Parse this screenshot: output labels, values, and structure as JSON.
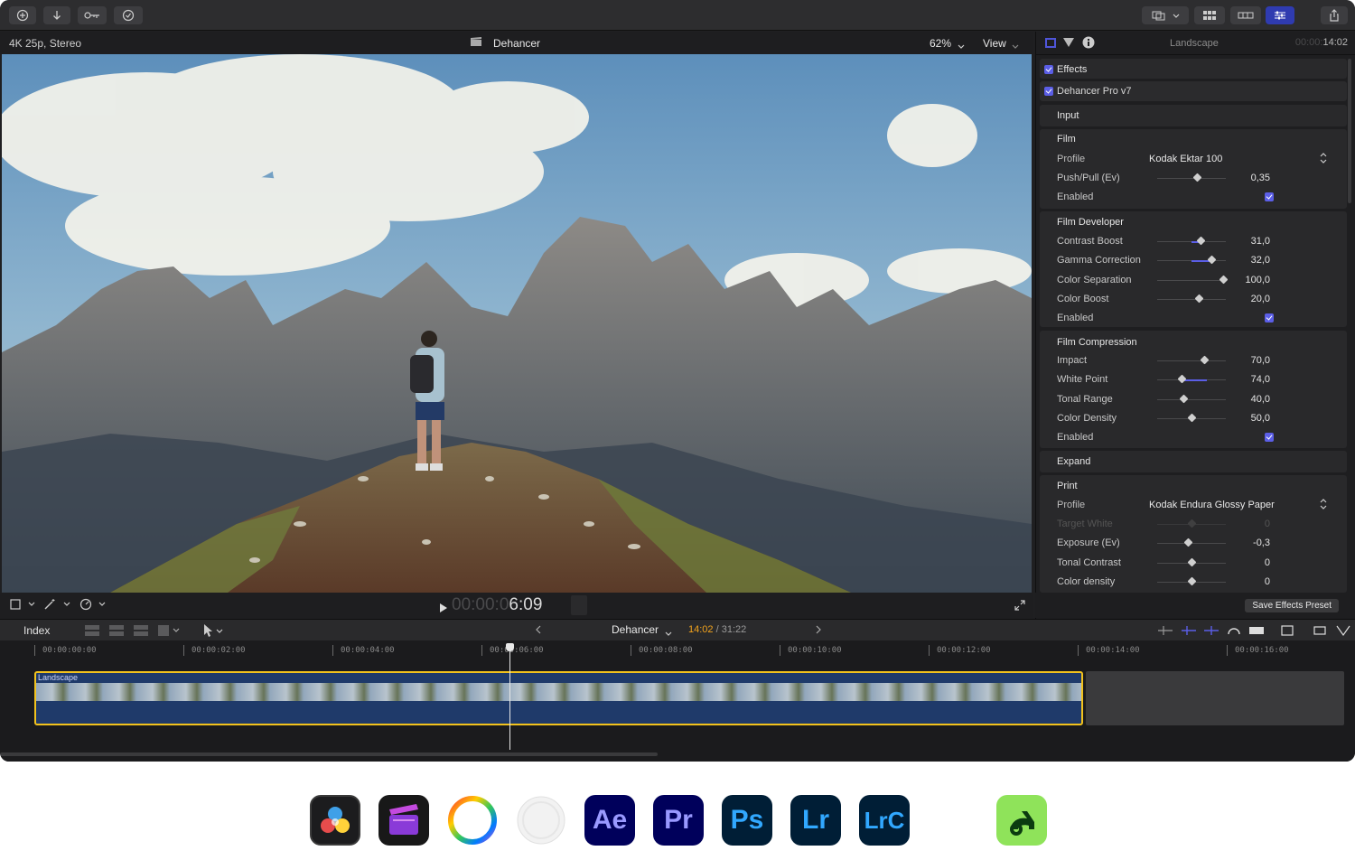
{
  "toolbar": {
    "left_buttons": [
      "add-media-icon",
      "import-icon",
      "keyword-icon",
      "checkmark-icon"
    ],
    "right_buttons": [
      "browser-toggle-icon",
      "dropdown-chevron-icon",
      "grid-view-icon",
      "filmstrip-icon",
      "inspector-icon",
      "share-icon"
    ]
  },
  "viewer": {
    "format": "4K 25p, Stereo",
    "title": "Dehancer",
    "zoom": "62%",
    "view_label": "View",
    "timecode_dim": "00:00:0",
    "timecode_bright": "6:09"
  },
  "inspector": {
    "clip_name": "Landscape",
    "duration_dim": "00:00:",
    "duration": "14:02",
    "effects_label": "Effects",
    "plugin_label": "Dehancer Pro v7",
    "input_label": "Input",
    "film": {
      "title": "Film",
      "profile_label": "Profile",
      "profile_value": "Kodak Ektar 100",
      "rows": [
        {
          "label": "Push/Pull (Ev)",
          "value": "0,35",
          "pos": 0.58
        },
        {
          "label": "Enabled",
          "value": ""
        }
      ]
    },
    "film_developer": {
      "title": "Film Developer",
      "rows": [
        {
          "label": "Contrast Boost",
          "value": "31,0",
          "pos": 0.63,
          "fill_from": 0.5
        },
        {
          "label": "Gamma Correction",
          "value": "32,0",
          "pos": 0.79,
          "fill_from": 0.5
        },
        {
          "label": "Color Separation",
          "value": "100,0",
          "pos": 0.96
        },
        {
          "label": "Color Boost",
          "value": "20,0",
          "pos": 0.6
        },
        {
          "label": "Enabled",
          "value": ""
        }
      ]
    },
    "film_compression": {
      "title": "Film Compression",
      "rows": [
        {
          "label": "Impact",
          "value": "70,0",
          "pos": 0.68
        },
        {
          "label": "White Point",
          "value": "74,0",
          "pos": 0.35,
          "fill_to": 0.72
        },
        {
          "label": "Tonal Range",
          "value": "40,0",
          "pos": 0.38
        },
        {
          "label": "Color Density",
          "value": "50,0",
          "pos": 0.5
        },
        {
          "label": "Enabled",
          "value": ""
        }
      ]
    },
    "expand_label": "Expand",
    "print": {
      "title": "Print",
      "profile_label": "Profile",
      "profile_value": "Kodak Endura Glossy Paper",
      "rows": [
        {
          "label": "Target White",
          "value": "0",
          "dim": true,
          "pos": 0.5
        },
        {
          "label": "Exposure (Ev)",
          "value": "-0,3",
          "pos": 0.45
        },
        {
          "label": "Tonal Contrast",
          "value": "0",
          "pos": 0.5
        },
        {
          "label": "Color density",
          "value": "0",
          "pos": 0.5
        }
      ]
    },
    "save_preset": "Save Effects Preset"
  },
  "timeline": {
    "index_label": "Index",
    "project_name": "Dehancer",
    "position": "14:02",
    "total": "/ 31:22",
    "ruler": [
      "00:00:00:00",
      "00:00:02:00",
      "00:00:04:00",
      "00:00:06:00",
      "00:00:08:00",
      "00:00:10:00",
      "00:00:12:00",
      "00:00:14:00",
      "00:00:16:00"
    ],
    "clip_label": "Landscape"
  },
  "dock": [
    {
      "name": "davinci-resolve-icon",
      "text": ""
    },
    {
      "name": "final-cut-pro-icon",
      "text": ""
    },
    {
      "name": "color-wheel-icon",
      "text": ""
    },
    {
      "name": "white-circle-icon",
      "text": ""
    },
    {
      "name": "after-effects-icon",
      "text": "Ae"
    },
    {
      "name": "premiere-pro-icon",
      "text": "Pr"
    },
    {
      "name": "photoshop-icon",
      "text": "Ps"
    },
    {
      "name": "lightroom-icon",
      "text": "Lr"
    },
    {
      "name": "lightroom-classic-icon",
      "text": "LrC"
    },
    {
      "name": "affinity-icon",
      "text": ""
    }
  ],
  "colors": {
    "accent": "#5b5ee6",
    "clip_border": "#f2c21d",
    "timecode_highlight": "#f2a31d"
  }
}
